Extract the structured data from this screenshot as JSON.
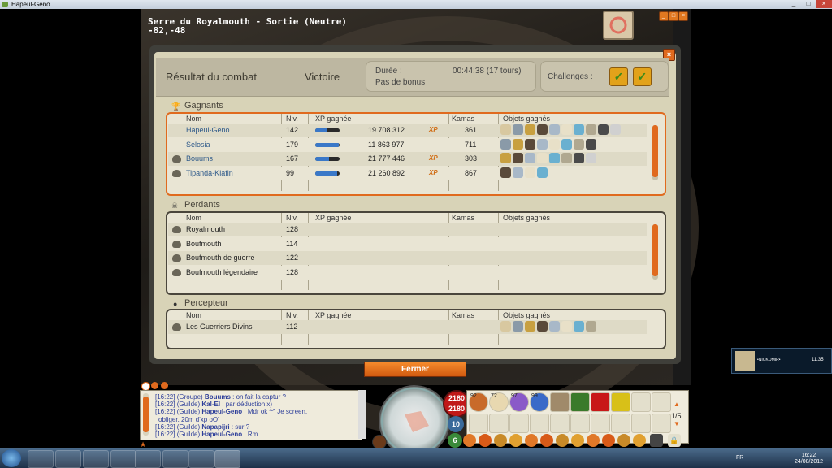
{
  "window": {
    "title": "Hapeul-Geno",
    "controls": [
      "_",
      "□",
      "×"
    ]
  },
  "map": {
    "name": "Serre du Royalmouth - Sortie (Neutre)",
    "coords": "-82,-48"
  },
  "combat": {
    "title": "Résultat du combat",
    "result": "Victoire",
    "duration_label": "Durée :",
    "duration_value": "00:44:38 (17 tours)",
    "bonus": "Pas de bonus",
    "challenges_label": "Challenges :",
    "columns": {
      "name": "Nom",
      "level": "Niv.",
      "xp": "XP gagnée",
      "kamas": "Kamas",
      "items": "Objets gagnés"
    },
    "winners": {
      "title": "Gagnants",
      "rows": [
        {
          "name": "Hapeul-Geno",
          "level": "142",
          "xp": "19 708 312",
          "xp_badge": "XP",
          "kamas": "361",
          "xp_progress": 0.45,
          "dead": false
        },
        {
          "name": "Selosia",
          "level": "179",
          "xp": "11 863 977",
          "xp_badge": "",
          "kamas": "711",
          "xp_progress": 0.95,
          "dead": false
        },
        {
          "name": "Bouums",
          "level": "167",
          "xp": "21 777 446",
          "xp_badge": "XP",
          "kamas": "303",
          "xp_progress": 0.55,
          "dead": true
        },
        {
          "name": "Tipanda-Kiafin",
          "level": "99",
          "xp": "21 260 892",
          "xp_badge": "XP",
          "kamas": "867",
          "xp_progress": 0.9,
          "dead": true
        }
      ]
    },
    "losers": {
      "title": "Perdants",
      "rows": [
        {
          "name": "Royalmouth",
          "level": "128"
        },
        {
          "name": "Boufmouth",
          "level": "114"
        },
        {
          "name": "Boufmouth de guerre",
          "level": "122"
        },
        {
          "name": "Boufmouth légendaire",
          "level": "128"
        }
      ]
    },
    "collector": {
      "title": "Percepteur",
      "rows": [
        {
          "name": "Les Guerriers Divins",
          "level": "112"
        }
      ]
    },
    "close_label": "Fermer"
  },
  "chat": {
    "lines": [
      {
        "time": "[16:22]",
        "channel": "(Groupe)",
        "user": "Bouums",
        "text": ": on fait la captur ?"
      },
      {
        "time": "[16:22]",
        "channel": "(Guilde)",
        "user": "Kal-El",
        "text": ": par déduction x)"
      },
      {
        "time": "[16:22]",
        "channel": "(Guilde)",
        "user": "Hapeul-Geno",
        "text": ": Mdr ok ^^ Je screen,"
      },
      {
        "time": "",
        "channel": "",
        "user": "",
        "text": "obliger. 20m d'xp oO'"
      },
      {
        "time": "[16:22]",
        "channel": "(Guilde)",
        "user": "Napapijri",
        "text": ": sur ?"
      },
      {
        "time": "[16:22]",
        "channel": "(Guilde)",
        "user": "Hapeul-Geno",
        "text": ": Rm"
      }
    ]
  },
  "hud": {
    "hp_current": "2180",
    "hp_max": "2180",
    "ap": "10",
    "mp": "6",
    "slot_counts": [
      "92",
      "72",
      "97",
      "99"
    ],
    "page": "1/5"
  },
  "taskbar": {
    "lang": "FR",
    "time": "16:22",
    "date": "24/08/2012"
  },
  "notification": {
    "text": "•NICKOMIR•",
    "time": "11:35"
  }
}
